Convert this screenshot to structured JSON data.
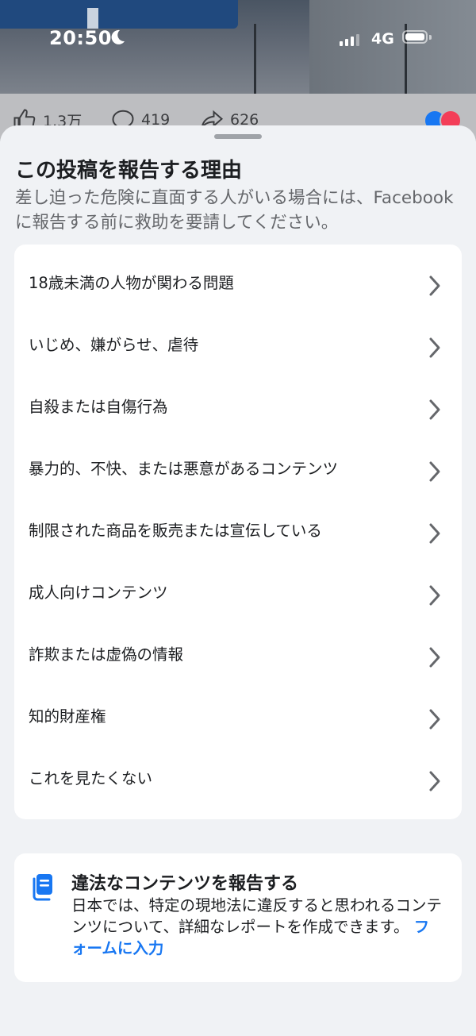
{
  "status_bar": {
    "time": "20:50",
    "network": "4G"
  },
  "background_post": {
    "likes": "1.3万",
    "comments": "419",
    "shares": "626",
    "reaction_colors": [
      "#1877f2",
      "#f33e58"
    ]
  },
  "sheet": {
    "title": "この投稿を報告する理由",
    "subtitle": "差し迫った危険に直面する人がいる場合には、Facebookに報告する前に救助を要請してください。",
    "reasons": [
      {
        "label": "18歳未満の人物が関わる問題"
      },
      {
        "label": "いじめ、嫌がらせ、虐待"
      },
      {
        "label": "自殺または自傷行為"
      },
      {
        "label": "暴力的、不快、または悪意があるコンテンツ"
      },
      {
        "label": "制限された商品を販売または宣伝している"
      },
      {
        "label": "成人向けコンテンツ"
      },
      {
        "label": "詐欺または虚偽の情報"
      },
      {
        "label": "知的財産権"
      },
      {
        "label": "これを見たくない"
      }
    ],
    "legal": {
      "icon": "document-icon",
      "title": "違法なコンテンツを報告する",
      "description": "日本では、特定の現地法に違反すると思われるコンテンツについて、詳細なレポートを作成できます。",
      "link_label": "フォームに入力"
    }
  },
  "colors": {
    "accent": "#1877f2",
    "sheet_background": "#f0f2f5",
    "card_background": "#ffffff"
  }
}
